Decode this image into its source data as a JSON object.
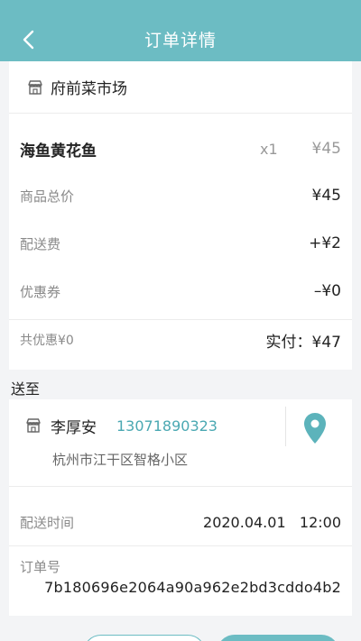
{
  "header": {
    "title": "订单详情",
    "back_icon": "chevron-left-icon",
    "background": "#6cbcc3"
  },
  "shop": {
    "icon": "store-icon",
    "name": "府前菜市场"
  },
  "item": {
    "name": "海鱼黄花鱼",
    "qty": "x1",
    "price": "¥45"
  },
  "fees": [
    {
      "label": "商品总价",
      "value": "¥45"
    },
    {
      "label": "配送费",
      "value": "+¥2"
    },
    {
      "label": "优惠券",
      "value": "–¥0"
    }
  ],
  "summary": {
    "discount": "共优惠¥0",
    "paid": "实付：¥47"
  },
  "delivery": {
    "section_label": "送至",
    "name": "李厚安",
    "phone": "13071890323",
    "address": "杭州市江干区智格小区",
    "pin_icon": "map-pin-icon",
    "accent": "#4aa8b2",
    "time_label": "配送时间",
    "time_value": "2020.04.01   12:00",
    "order_label": "订单号",
    "order_id": "7b180696e2064a90a962e2bd3cddo4b2"
  }
}
